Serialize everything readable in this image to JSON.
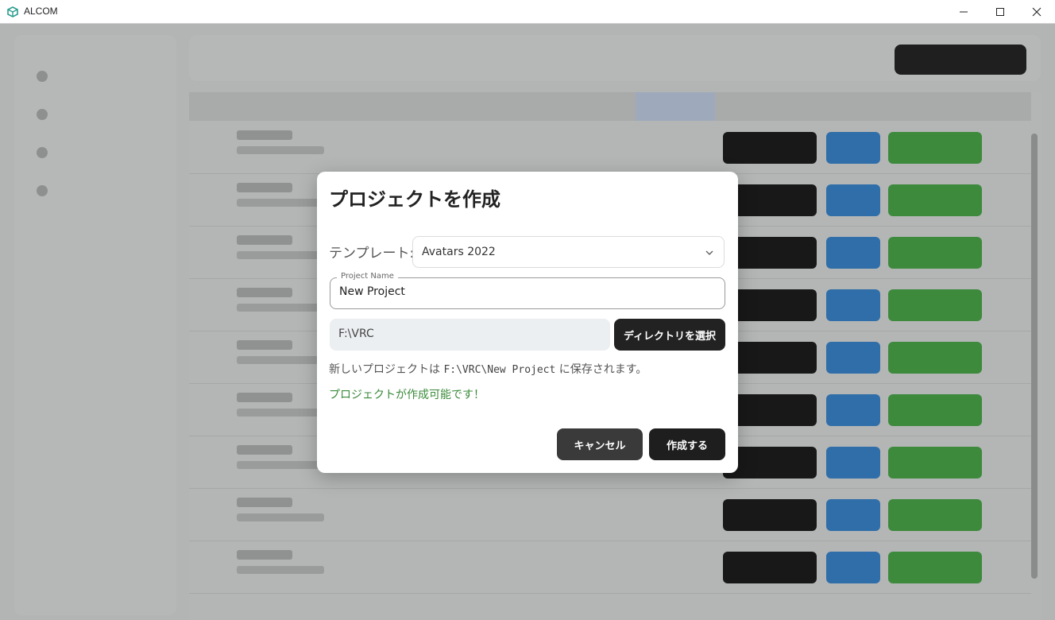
{
  "window": {
    "title": "ALCOM",
    "logo_icon": "alcom-cube-icon",
    "logo_color": "#2a9d8f"
  },
  "dialog": {
    "title": "プロジェクトを作成",
    "template_label": "テンプレート:",
    "template_value": "Avatars 2022",
    "project_name_label": "Project Name",
    "project_name_value": "New Project",
    "directory_value": "F:\\VRC",
    "choose_directory_label": "ディレクトリを選択",
    "save_prefix": "新しいプロジェクトは",
    "save_path": "F:\\VRC\\New Project",
    "save_suffix": "に保存されます。",
    "status_message": "プロジェクトが作成可能です！",
    "status_color": "#3a8a3a",
    "cancel_label": "キャンセル",
    "create_label": "作成する"
  }
}
